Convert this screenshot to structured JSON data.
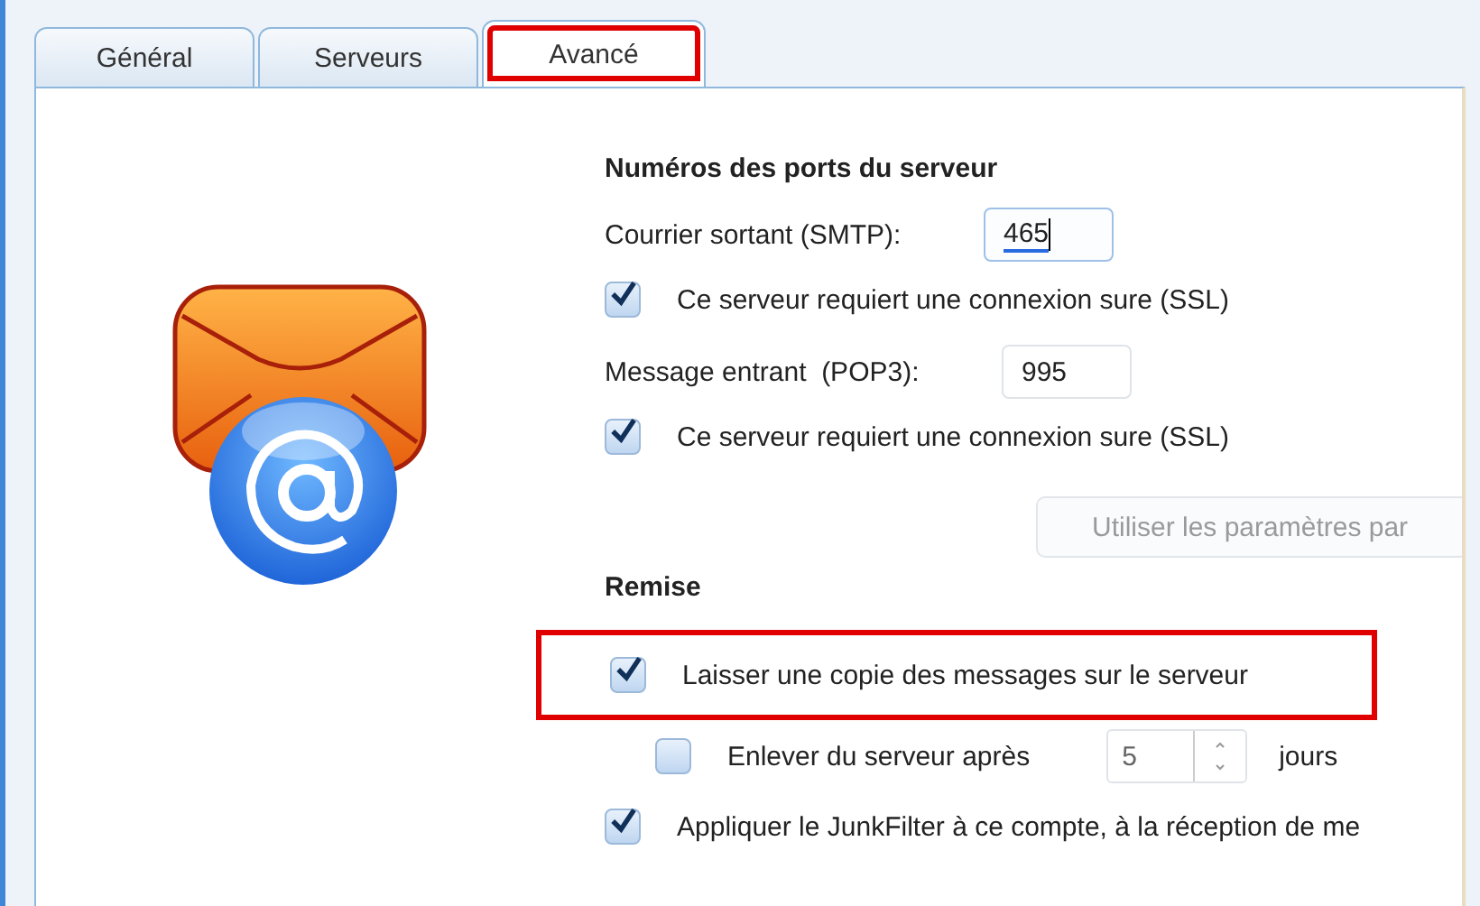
{
  "tabs": [
    {
      "label": "Général",
      "selected": false,
      "highlighted": false
    },
    {
      "label": "Serveurs",
      "selected": false,
      "highlighted": false
    },
    {
      "label": "Avancé",
      "selected": true,
      "highlighted": true
    }
  ],
  "ports": {
    "heading": "Numéros des ports du serveur",
    "fields": [
      {
        "label": "Courrier sortant (SMTP):",
        "value": "465",
        "focused": true,
        "ssl": {
          "label": "Ce serveur requiert une connexion sure (SSL)",
          "checked": true
        }
      },
      {
        "label": "Message entrant  (POP3):",
        "value": "995",
        "focused": false,
        "ssl": {
          "label": "Ce serveur requiert une connexion sure (SSL)",
          "checked": true
        }
      }
    ],
    "defaults_button": {
      "label": "Utiliser les paramètres par",
      "disabled": true
    }
  },
  "delivery": {
    "heading": "Remise",
    "leave_copy": {
      "label": "Laisser une copie des messages sur le serveur",
      "checked": true,
      "highlighted": true
    },
    "remove_after": {
      "label": "Enlever du serveur après",
      "checked": false,
      "value": "5",
      "unit": "jours"
    },
    "junkfilter": {
      "label": "Appliquer le JunkFilter à ce compte, à la réception de me",
      "checked": true
    }
  }
}
